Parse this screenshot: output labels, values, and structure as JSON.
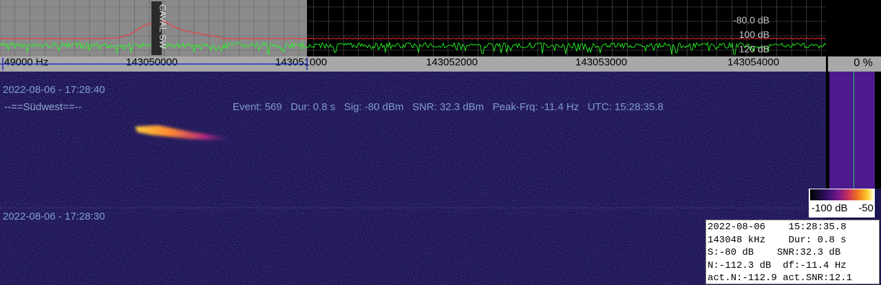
{
  "spectrum": {
    "db_labels": [
      "-80.0 dB",
      "100 dB",
      "120 dB"
    ],
    "marker_label": "CAVAL SW",
    "colors": {
      "trace_avg": "#ff3030",
      "trace_live": "#22ff22",
      "grid": "#606060",
      "selection": "#8a8a8a"
    }
  },
  "freq_axis": {
    "labels": [
      "49000 Hz",
      "143050000",
      "143051000",
      "143052000",
      "143053000",
      "143054000"
    ]
  },
  "percent": "0 %",
  "waterfall": {
    "timestamp_top": "2022-08-06 - 17:28:40",
    "timestamp_bottom": "2022-08-06 - 17:28:30",
    "station": "--==Südwest==--",
    "event_line": "Event: 569   Dur: 0.8 s   Sig: -80 dBm   SNR: 32.3 dBm   Peak-Frq: -11.4 Hz   UTC: 15:28:35.8"
  },
  "scale": {
    "min_label": "-100 dB",
    "max_label": "-50"
  },
  "info": {
    "line1": "2022-08-06    15:28:35.8",
    "line2": "143048 kHz    Dur: 0.8 s",
    "line3": "S:-80 dB    SNR:32.3 dB",
    "line4": "N:-112.3 dB  df:-11.4 Hz",
    "line5": "act.N:-112.9 act.SNR:12.1"
  }
}
